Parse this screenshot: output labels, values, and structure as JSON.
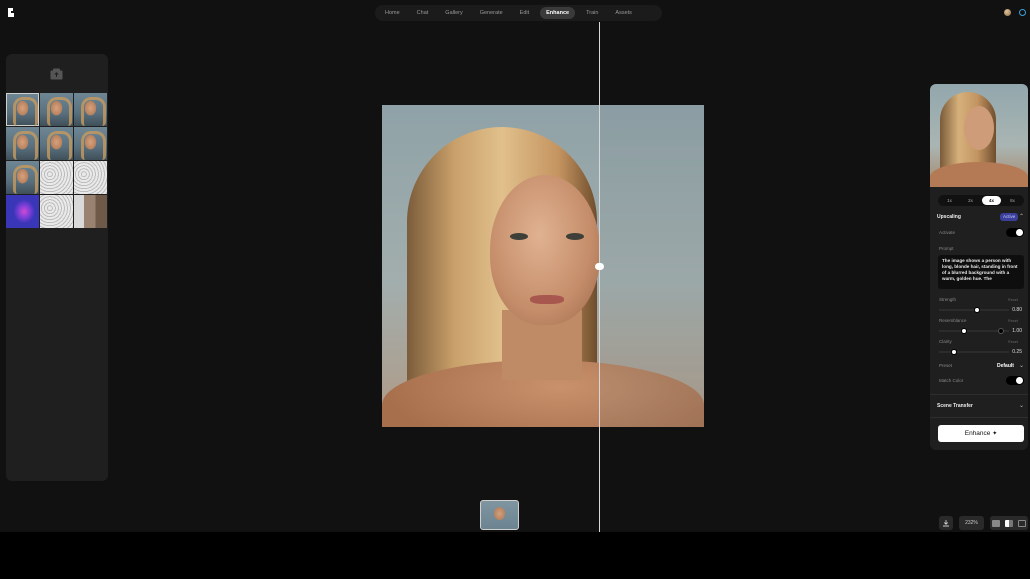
{
  "nav": {
    "items": [
      {
        "label": "Home"
      },
      {
        "label": "Chat"
      },
      {
        "label": "Gallery"
      },
      {
        "label": "Generate"
      },
      {
        "label": "Edit"
      },
      {
        "label": "Enhance"
      },
      {
        "label": "Train"
      },
      {
        "label": "Assets"
      }
    ],
    "active": "Enhance"
  },
  "panel": {
    "scales": [
      "1x",
      "2x",
      "4x",
      "8x"
    ],
    "selected_scale": "4x",
    "upscaling": {
      "title": "Upscaling",
      "badge": "Active",
      "activate_label": "Activate",
      "prompt_label": "Prompt",
      "prompt_text": "The image shows a person with long, blonde hair, standing in front of a blurred background with a warm, golden hue. The",
      "strength_label": "Strength",
      "strength_value": "0.80",
      "resemblance_label": "Resemblance",
      "resemblance_value": "1.00",
      "clarity_label": "Clarity",
      "clarity_value": "0.25",
      "reset_label": "Reset",
      "preset_label": "Preset",
      "preset_value": "Default",
      "match_color_label": "Match Color"
    },
    "scene_transfer_label": "Scene Transfer",
    "enhance_label": "Enhance"
  },
  "bottom": {
    "zoom": "232%"
  }
}
